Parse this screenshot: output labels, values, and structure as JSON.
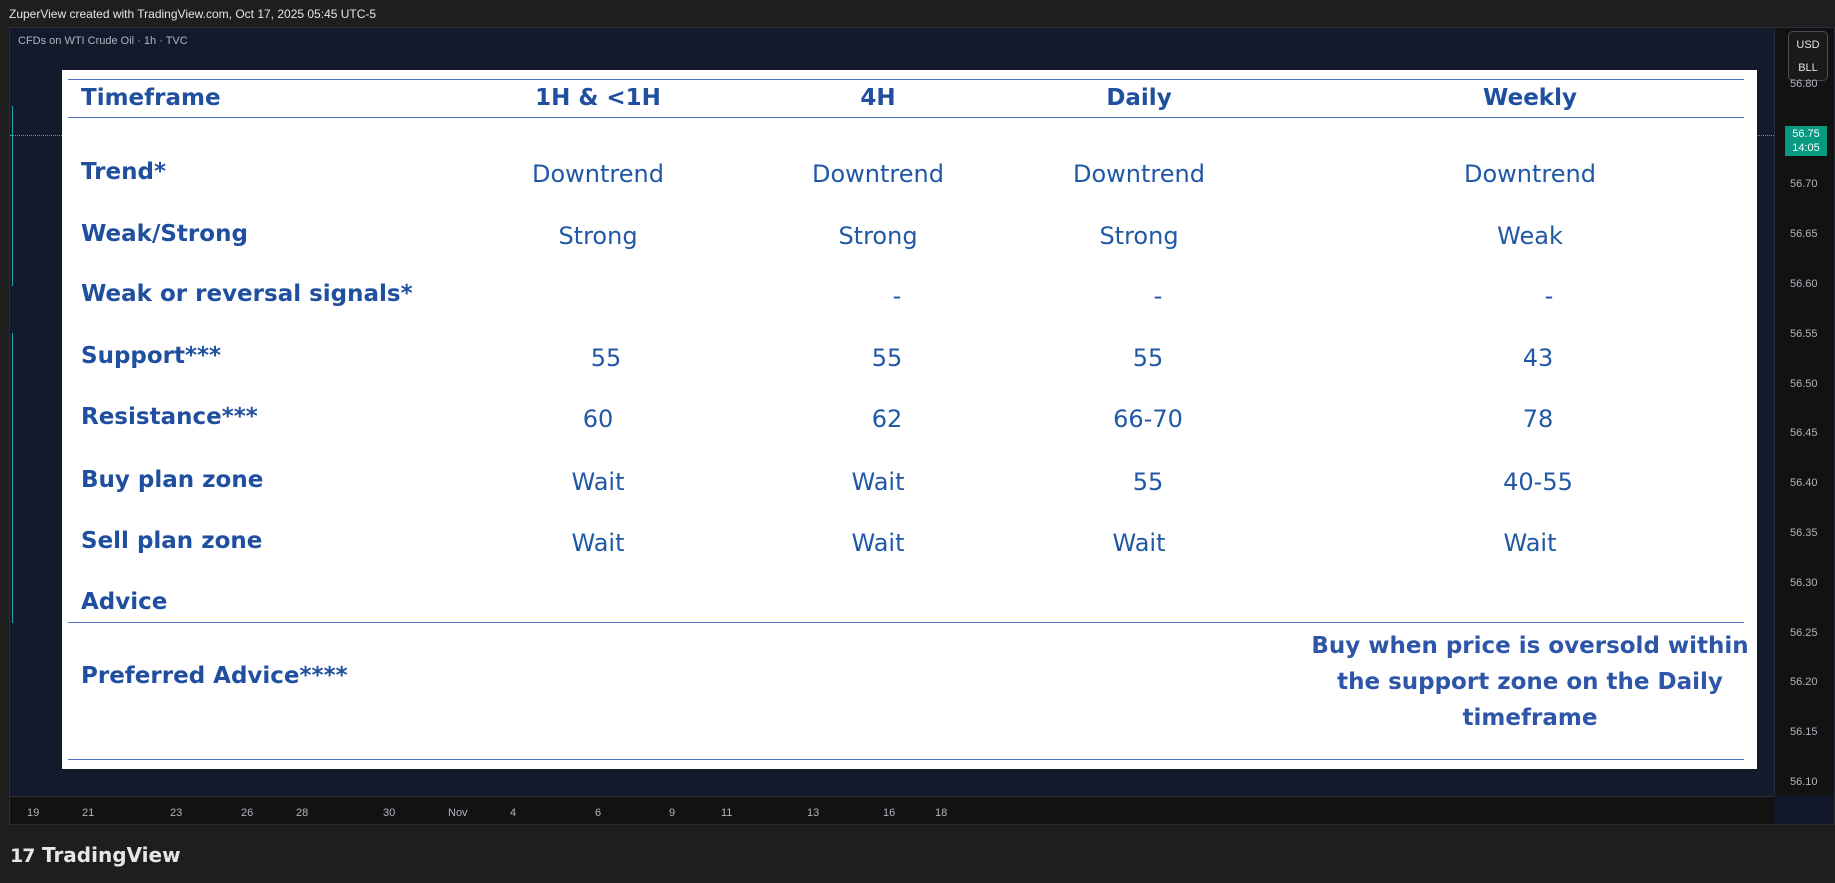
{
  "topbar": {
    "caption": "ZuperView created with TradingView.com, Oct 17, 2025 05:45 UTC-5"
  },
  "chart": {
    "symbol": "CFDs on WTI Crude Oil · 1h · TVC",
    "currency": "USD",
    "unit": "BLL",
    "current_price": "56.75",
    "countdown": "14:05",
    "accent_color": "#089981",
    "price_ticks": [
      "56.80",
      "56.70",
      "56.65",
      "56.60",
      "56.55",
      "56.50",
      "56.45",
      "56.40",
      "56.35",
      "56.30",
      "56.25",
      "56.20",
      "56.15",
      "56.10"
    ],
    "time_ticks": [
      "19",
      "21",
      "23",
      "26",
      "28",
      "30",
      "Nov",
      "4",
      "6",
      "9",
      "11",
      "13",
      "16",
      "18"
    ]
  },
  "table": {
    "headers": [
      "Timeframe",
      "1H & <1H",
      "4H",
      "Daily",
      "Weekly"
    ],
    "rows": [
      {
        "label": "Trend*",
        "values": [
          "Downtrend",
          "Downtrend",
          "Downtrend",
          "Downtrend"
        ]
      },
      {
        "label": "Weak/Strong",
        "values": [
          "Strong",
          "Strong",
          "Strong",
          "Weak"
        ]
      },
      {
        "label": "Weak or reversal signals*",
        "values": [
          "",
          "-",
          "-",
          "-"
        ]
      },
      {
        "label": "Support***",
        "values": [
          "55",
          "55",
          "55",
          "43"
        ]
      },
      {
        "label": "Resistance***",
        "values": [
          "60",
          "62",
          "66-70",
          "78"
        ]
      },
      {
        "label": "Buy plan zone",
        "values": [
          "Wait",
          "Wait",
          "55",
          "40-55"
        ]
      },
      {
        "label": "Sell plan zone",
        "values": [
          "Wait",
          "Wait",
          "Wait",
          "Wait"
        ]
      },
      {
        "label": "Advice",
        "values": [
          "",
          "",
          "",
          ""
        ]
      }
    ],
    "preferred_label": "Preferred Advice****",
    "preferred_text": "Buy when price is oversold within the support zone on the Daily timeframe",
    "text_color": "#1f4f9e"
  },
  "footer": {
    "brand": "TradingView",
    "logo_mark": "17"
  }
}
